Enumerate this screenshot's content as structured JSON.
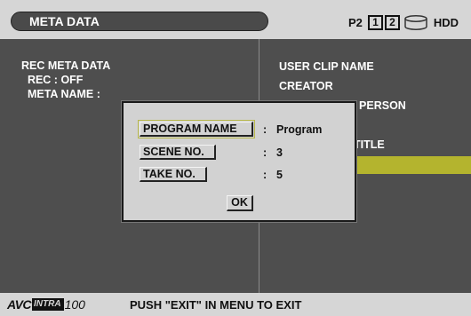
{
  "header": {
    "title": "META DATA",
    "media_label": "P2",
    "slots": [
      "1",
      "2"
    ],
    "hdd_icon": "hdd-drum-icon",
    "hdd_label": "HDD"
  },
  "left_panel": {
    "lines": [
      "REC META DATA",
      "  REC : OFF",
      "  META NAME :"
    ]
  },
  "right_menu": {
    "items": [
      "USER CLIP NAME",
      "CREATOR",
      "LAST UPDATE PERSON",
      "",
      "TITLE",
      "",
      "",
      ""
    ]
  },
  "dialog": {
    "fields": [
      {
        "label": "PROGRAM NAME",
        "value": "Program"
      },
      {
        "label": "SCENE NO.",
        "value": "3"
      },
      {
        "label": "TAKE NO.",
        "value": "5"
      }
    ],
    "colon": ":",
    "ok_label": "OK"
  },
  "footer": {
    "logo_avc": "AVC",
    "logo_intra": "INTRA",
    "logo_num": "100",
    "message": "PUSH \"EXIT\" IN MENU TO EXIT"
  },
  "colors": {
    "highlight": "#b4b42e",
    "background": "#4e4e4e",
    "bars": "#d6d6d6"
  }
}
